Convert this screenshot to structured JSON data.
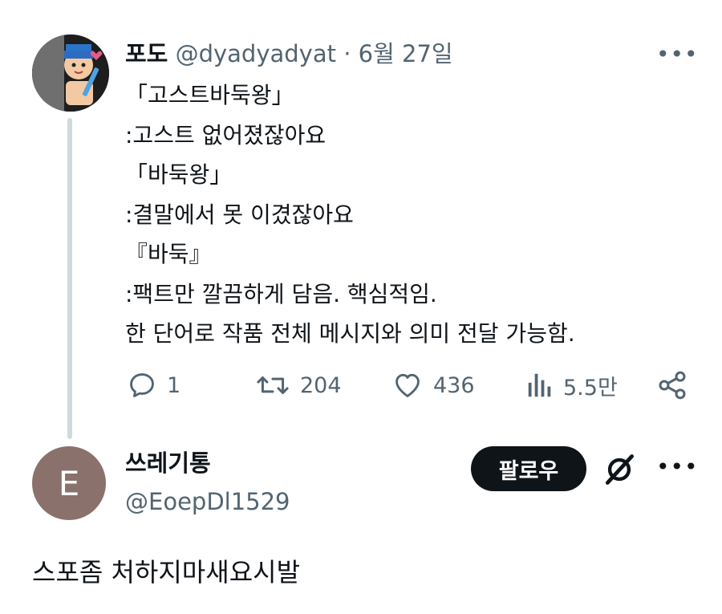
{
  "tweet1": {
    "author_name": "포도",
    "handle": "@dyadyadyat",
    "separator": "·",
    "date": "6월 27일",
    "lines": [
      "「고스트바둑왕」",
      ":고스트 없어졌잖아요",
      "「바둑왕」",
      ":결말에서 못 이겼잖아요",
      "『바둑』",
      ":팩트만 깔끔하게 담음. 핵심적임.",
      "한 단어로 작품 전체 메시지와 의미 전달 가능함."
    ],
    "stats": {
      "replies": "1",
      "retweets": "204",
      "likes": "436",
      "views": "5.5만"
    }
  },
  "reply_user": {
    "avatar_letter": "E",
    "name": "쓰레기통",
    "handle": "@EoepDl1529",
    "follow_label": "팔로우"
  },
  "reply_text": "스포좀 처하지마새요시발",
  "colors": {
    "text": "#0f1419",
    "muted": "#536471",
    "thread_line": "#cfd9de",
    "avatar2_bg": "#8a716c"
  }
}
